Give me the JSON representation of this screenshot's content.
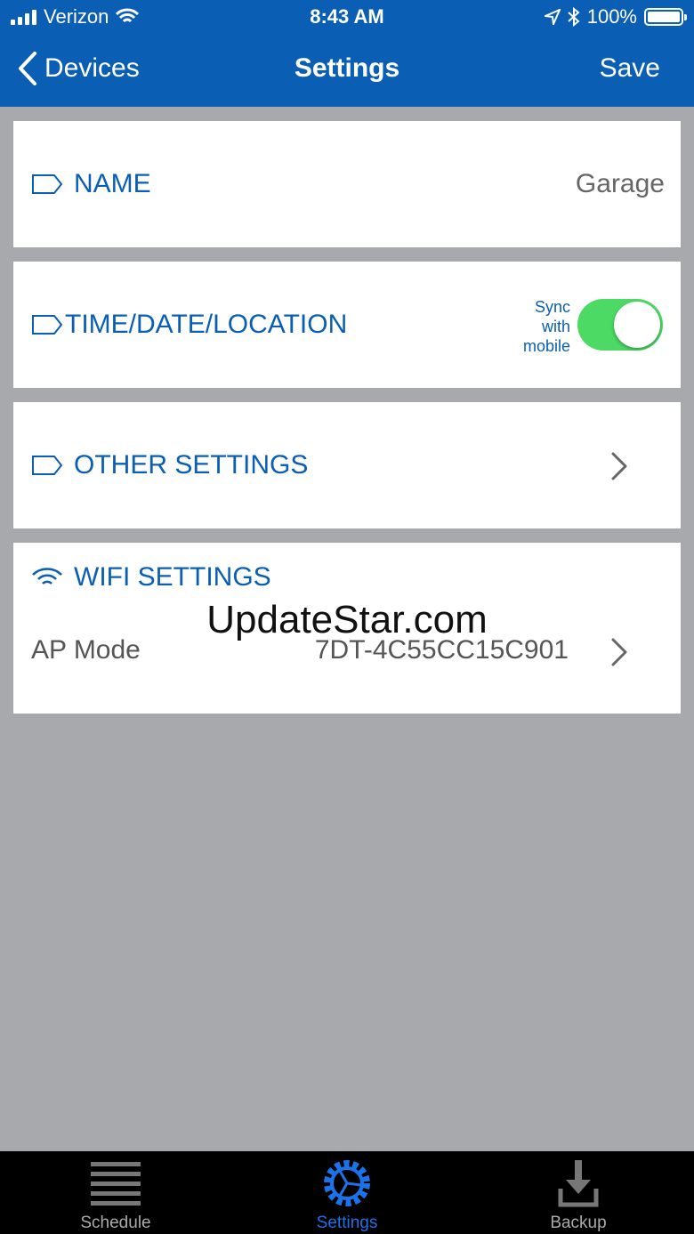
{
  "status_bar": {
    "carrier": "Verizon",
    "time": "8:43 AM",
    "battery": "100%"
  },
  "nav": {
    "back_label": "Devices",
    "title": "Settings",
    "save_label": "Save"
  },
  "name_card": {
    "label": "NAME",
    "value": "Garage",
    "icon": "tag-icon"
  },
  "time_card": {
    "label": "TIME/DATE/LOCATION",
    "sync_line1": "Sync",
    "sync_line2": "with",
    "sync_line3": "mobile",
    "sync_on": true,
    "toggle_color": "#4cd964"
  },
  "other_card": {
    "label": "OTHER SETTINGS"
  },
  "wifi_card": {
    "label": "WIFI SETTINGS",
    "icon": "wifi-icon",
    "mode_label": "AP Mode",
    "network": "7DT-4C55CC15C901"
  },
  "watermark": "UpdateStar.com",
  "tabs": [
    {
      "label": "Schedule",
      "icon": "schedule-icon",
      "active": false
    },
    {
      "label": "Settings",
      "icon": "gear-icon",
      "active": true
    },
    {
      "label": "Backup",
      "icon": "download-icon",
      "active": false
    }
  ],
  "colors": {
    "brand": "#0a5fb4",
    "background": "#a7a9ac",
    "active_tab": "#1a73e8"
  }
}
